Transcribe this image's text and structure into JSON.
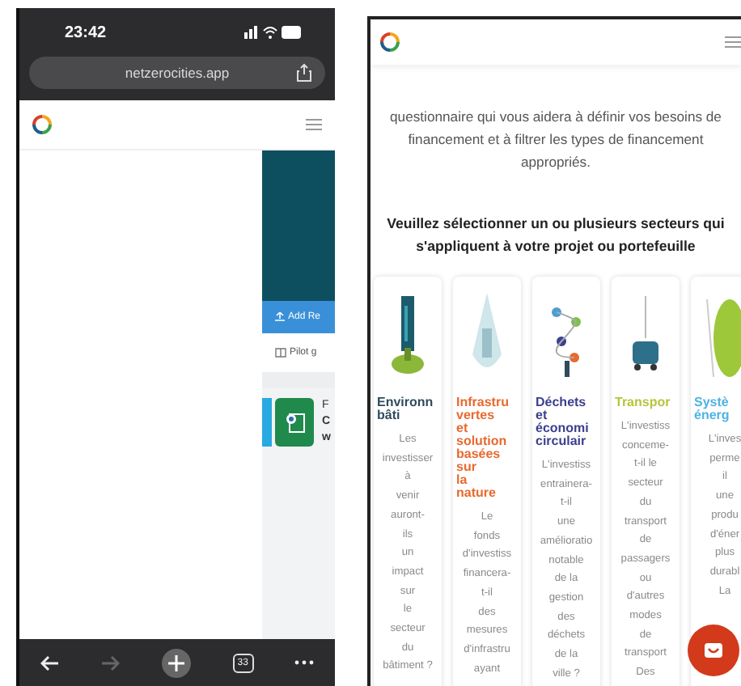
{
  "left_phone": {
    "status_bar": {
      "time": "23:42"
    },
    "address_bar": {
      "url": "netzerocities.app"
    },
    "page": {
      "add_button": "Add Re",
      "pilot_link": "Pilot g",
      "item_texts": [
        {
          "text": "F",
          "bold": false
        },
        {
          "text": "C",
          "bold": true
        },
        {
          "text": "w",
          "bold": true
        }
      ]
    },
    "toolbar": [
      {
        "kind": "back",
        "disabled": false
      },
      {
        "kind": "forward",
        "disabled": true
      },
      {
        "kind": "new-tab",
        "disabled": false
      },
      {
        "kind": "tabs",
        "disabled": false,
        "label": "33"
      },
      {
        "kind": "more",
        "disabled": false
      }
    ]
  },
  "right_phone": {
    "intro": "questionnaire qui vous aidera à définir vos besoins de financement et à filtrer les types de financement appropriés.",
    "heading": "Veuillez sélectionner un ou plusieurs secteurs qui s'appliquent à votre projet ou portefeuille",
    "sectors": [
      {
        "color": "#2f4b5c",
        "title": [
          "Environn",
          "bâti"
        ],
        "description": [
          "Les",
          "investisser",
          "à",
          "venir",
          "auront-",
          "ils",
          "un",
          "impact",
          "sur",
          "le",
          "secteur",
          "du",
          "bâtiment ?"
        ]
      },
      {
        "color": "#e8692e",
        "title": [
          "Infrastru",
          "vertes",
          "et",
          "solution",
          "basées",
          "sur",
          "la",
          "nature"
        ],
        "description": [
          "Le",
          "fonds",
          "d'investiss",
          "financera-",
          "t-il",
          "des",
          "mesures",
          "d'infrastru",
          "ayant"
        ]
      },
      {
        "color": "#3b3f8c",
        "title": [
          "Déchets",
          "et",
          "économi",
          "circulair"
        ],
        "description": [
          "L'investiss",
          "entrainera-",
          "t-il",
          "une",
          "amélioratio",
          "notable",
          "de la",
          "gestion",
          "des",
          "déchets",
          "de la",
          "ville ?"
        ]
      },
      {
        "color": "#b8c43c",
        "title": [
          "Transpor"
        ],
        "description": [
          "L'investiss",
          "conceme-",
          "t-il le",
          "secteur",
          "du",
          "transport",
          "de",
          "passagers",
          "ou",
          "d'autres",
          "modes",
          "de",
          "transport",
          "Des"
        ]
      },
      {
        "color": "#4fb3e3",
        "title": [
          "Systè",
          "énerg"
        ],
        "description": [
          "L'inves",
          "perme",
          "il",
          "une",
          "produ",
          "d'éner",
          "plus",
          "durabl",
          "La"
        ]
      }
    ]
  }
}
